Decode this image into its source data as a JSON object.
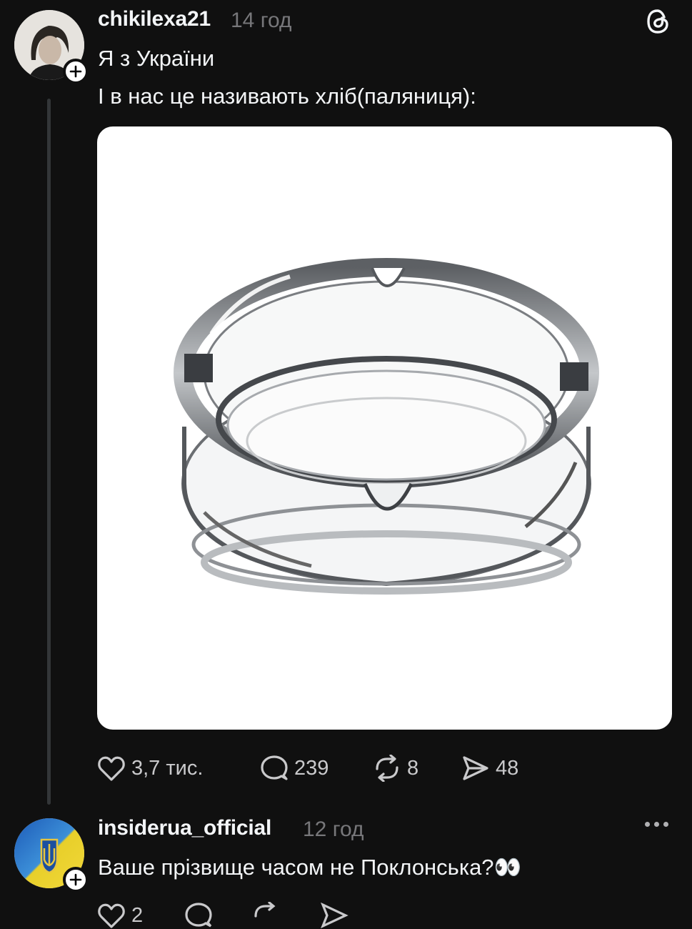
{
  "post": {
    "username": "chikilexa21",
    "time": "14 год",
    "line1": "Я з України",
    "line2": "І в нас це називають хліб(паляниця):",
    "likes": "3,7 тис.",
    "comments": "239",
    "reposts": "8",
    "shares": "48"
  },
  "reply": {
    "username": "insiderua_official",
    "time": "12 год",
    "text": "Ваше прізвище часом не Поклонська?👀",
    "likes": "2"
  },
  "icons": {
    "logo": "threads-logo-icon",
    "like": "heart-icon",
    "comment": "comment-bubble-icon",
    "repost": "repost-icon",
    "share": "send-icon",
    "more": "more-dots-icon",
    "follow": "plus-icon"
  }
}
